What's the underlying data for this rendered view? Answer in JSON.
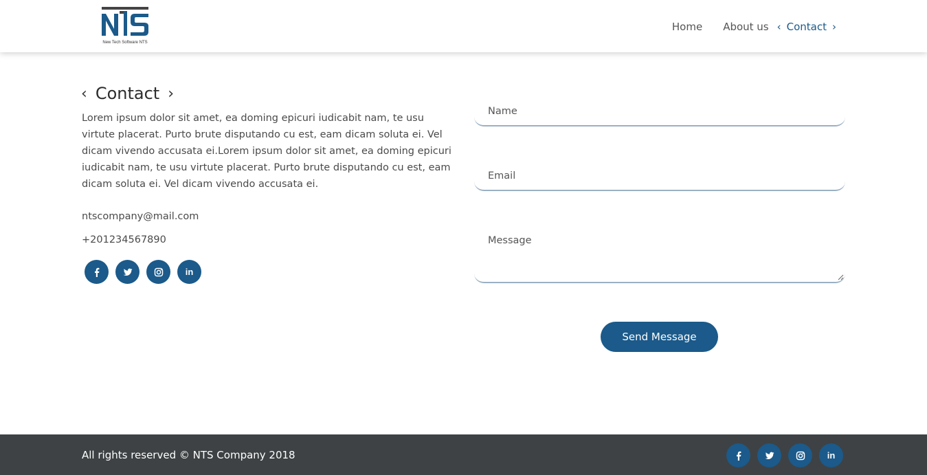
{
  "brand": {
    "logo_text": "NTS",
    "tagline": "New Tech Software NTS",
    "color": "#1b5a8a"
  },
  "nav": {
    "items": [
      {
        "label": "Home"
      },
      {
        "label": "About us"
      },
      {
        "label": "Contact",
        "active": true
      }
    ]
  },
  "contact": {
    "title": "Contact",
    "description": "Lorem ipsum dolor sit amet, ea doming epicuri iudicabit nam, te usu virtute placerat. Purto brute disputando cu est, eam dicam soluta ei. Vel dicam vivendo accusata ei.Lorem ipsum dolor sit amet, ea doming epicuri iudicabit nam, te usu virtute placerat. Purto brute disputando cu est, eam dicam soluta ei. Vel dicam vivendo accusata ei.",
    "email": "ntscompany@mail.com",
    "phone": "+201234567890"
  },
  "socials": [
    {
      "icon": "facebook-icon"
    },
    {
      "icon": "twitter-icon"
    },
    {
      "icon": "instagram-icon"
    },
    {
      "icon": "linkedin-icon"
    }
  ],
  "form": {
    "name_placeholder": "Name",
    "email_placeholder": "Email",
    "message_placeholder": "Message",
    "send_label": "Send Message"
  },
  "footer": {
    "copyright": "All rights reserved © NTS Company 2018",
    "background": "#3e4244"
  }
}
